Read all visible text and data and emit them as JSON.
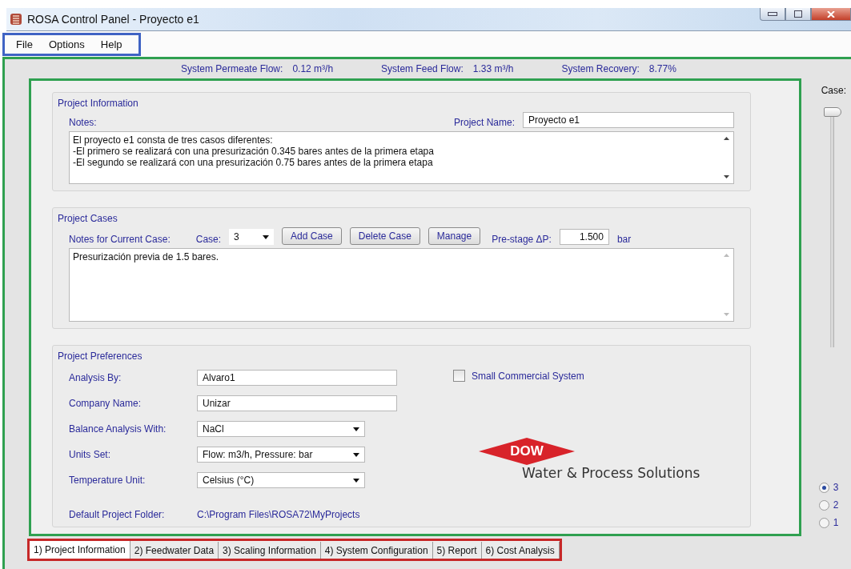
{
  "window": {
    "title": "ROSA Control Panel - Proyecto e1"
  },
  "menu": [
    "File",
    "Options",
    "Help"
  ],
  "summary": [
    {
      "label": "System Permeate Flow:",
      "value": "0.12 m³/h"
    },
    {
      "label": "System Feed Flow:",
      "value": "1.33 m³/h"
    },
    {
      "label": "System Recovery:",
      "value": "8.77%"
    }
  ],
  "project_information": {
    "title": "Project Information",
    "notes_label": "Notes:",
    "project_name_label": "Project Name:",
    "project_name": "Proyecto e1",
    "notes": [
      "El proyecto e1 consta de tres casos diferentes:",
      "-El primero se realizará con una presurización 0.345 bares antes de la primera etapa",
      "-El segundo se realizará con una presurización 0.75 bares antes de la primera etapa"
    ]
  },
  "project_cases": {
    "title": "Project Cases",
    "notes_label": "Notes for Current Case:",
    "case_label": "Case:",
    "case_value": "3",
    "buttons": [
      "Add Case",
      "Delete Case",
      "Manage"
    ],
    "prestage_label": "Pre-stage ΔP:",
    "prestage_value": "1.500",
    "prestage_unit": "bar",
    "notes": "Presurización previa de 1.5 bares."
  },
  "project_preferences": {
    "title": "Project Preferences",
    "fields": [
      {
        "kind": "text",
        "label": "Analysis By:",
        "value": "Alvaro1"
      },
      {
        "kind": "text",
        "label": "Company Name:",
        "value": "Unizar"
      },
      {
        "kind": "select",
        "label": "Balance Analysis With:",
        "value": "NaCl"
      },
      {
        "kind": "select",
        "label": "Units Set:",
        "value": "Flow: m3/h, Pressure: bar"
      },
      {
        "kind": "select",
        "label": "Temperature Unit:",
        "value": "Celsius (°C)"
      },
      {
        "kind": "path",
        "label": "Default Project Folder:",
        "value": "C:\\Program Files\\ROSA72\\MyProjects"
      }
    ],
    "small_commercial": {
      "label": "Small Commercial System",
      "checked": false
    },
    "logo": {
      "brand": "DOW",
      "tagline": "Water & Process Solutions"
    }
  },
  "case_selector": {
    "label": "Case:",
    "level": 1,
    "options": [
      {
        "label": "3",
        "selected": true
      },
      {
        "label": "2",
        "selected": false
      },
      {
        "label": "1",
        "selected": false
      }
    ]
  },
  "tabs": [
    {
      "label": "1) Project Information",
      "selected": true
    },
    {
      "label": "2) Feedwater Data",
      "selected": false
    },
    {
      "label": "3) Scaling Information",
      "selected": false
    },
    {
      "label": "4) System Configuration",
      "selected": false
    },
    {
      "label": "5) Report",
      "selected": false
    },
    {
      "label": "6) Cost Analysis",
      "selected": false
    }
  ]
}
